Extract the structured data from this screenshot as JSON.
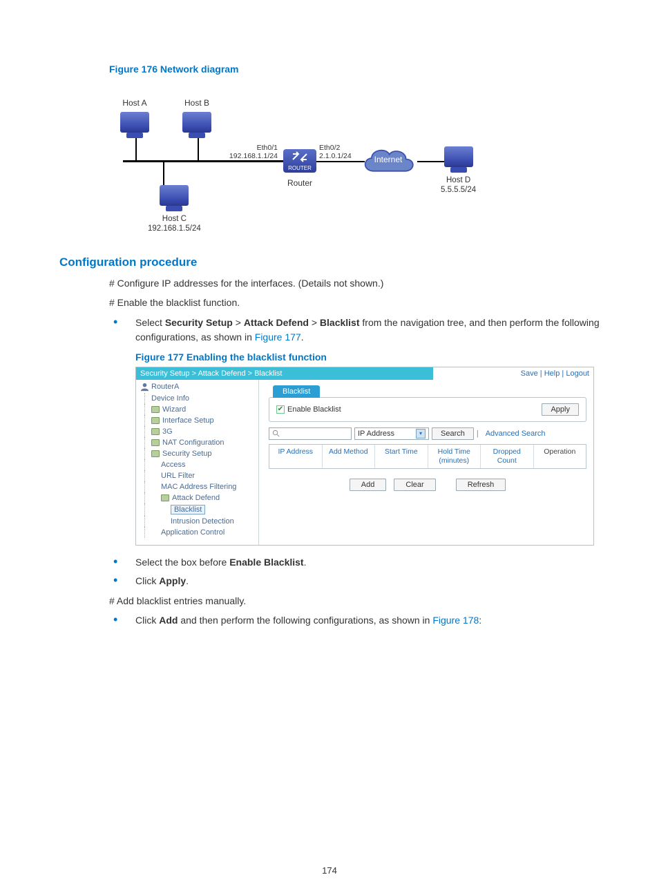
{
  "figure176_caption": "Figure 176 Network diagram",
  "diagram": {
    "hostA": "Host A",
    "hostB": "Host B",
    "hostC": "Host C",
    "hostC_ip": "192.168.1.5/24",
    "hostD": "Host D",
    "hostD_ip": "5.5.5.5/24",
    "eth01": "Eth0/1",
    "eth01_ip": "192.168.1.1/24",
    "eth02": "Eth0/2",
    "eth02_ip": "2.1.0.1/24",
    "router": "Router",
    "router_badge": "ROUTER",
    "internet": "Internet"
  },
  "section_config": "Configuration procedure",
  "step_ip": "# Configure IP addresses for the interfaces. (Details not shown.)",
  "step_enable": "# Enable the blacklist function.",
  "bullet_nav_pre": "Select ",
  "nav1": "Security Setup",
  "gt": " > ",
  "nav2": "Attack Defend",
  "nav3": "Blacklist",
  "bullet_nav_post1": " from the navigation tree, and then perform the following configurations, as shown in ",
  "fig177_link": "Figure 177",
  "period": ".",
  "figure177_caption": "Figure 177 Enabling the blacklist function",
  "ui": {
    "breadcrumb": "Security Setup > Attack Defend > Blacklist",
    "save": "Save",
    "help": "Help",
    "logout": "Logout",
    "root": "RouterA",
    "nav": {
      "device_info": "Device Info",
      "wizard": "Wizard",
      "interface_setup": "Interface Setup",
      "g3": "3G",
      "nat": "NAT Configuration",
      "security": "Security Setup",
      "access": "Access",
      "url_filter": "URL Filter",
      "mac_filter": "MAC Address Filtering",
      "attack_defend": "Attack Defend",
      "blacklist": "Blacklist",
      "intrusion": "Intrusion Detection",
      "app_control": "Application Control"
    },
    "tab_blacklist": "Blacklist",
    "enable_blacklist": "Enable Blacklist",
    "apply": "Apply",
    "search_placeholder": "",
    "dropdown_value": "IP Address",
    "search_btn": "Search",
    "advanced_search": "Advanced Search",
    "cols": {
      "ip": "IP Address",
      "method": "Add Method",
      "start": "Start Time",
      "hold": "Hold Time (minutes)",
      "dropped": "Dropped Count",
      "op": "Operation"
    },
    "add": "Add",
    "clear": "Clear",
    "refresh": "Refresh"
  },
  "bullet_select_pre": "Select the box before ",
  "bullet_select_bold": "Enable Blacklist",
  "bullet_click_pre": "Click ",
  "bullet_apply_bold": "Apply",
  "step_add": "# Add blacklist entries manually.",
  "bullet_add_pre": "Click ",
  "bullet_add_bold": "Add",
  "bullet_add_post": " and then perform the following configurations, as shown in ",
  "fig178_link": "Figure 178",
  "colon": ":",
  "page_number": "174"
}
